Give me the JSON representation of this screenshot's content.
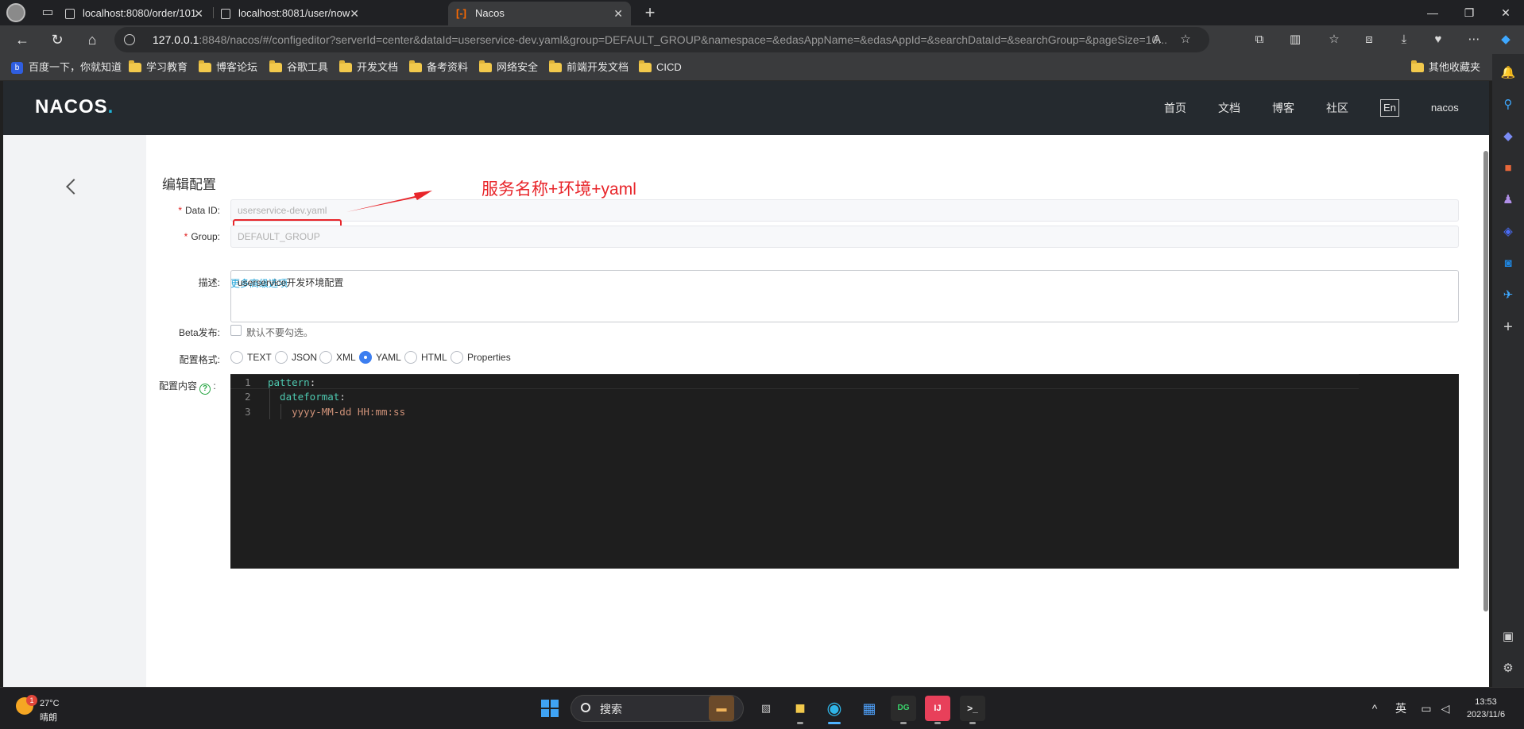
{
  "browser": {
    "tabs": [
      {
        "title": "localhost:8080/order/101"
      },
      {
        "title": "localhost:8081/user/now"
      },
      {
        "title": "Nacos"
      }
    ],
    "url": {
      "host": "127.0.0.1",
      "rest": ":8848/nacos/#/configeditor?serverId=center&dataId=userservice-dev.yaml&group=DEFAULT_GROUP&namespace=&edasAppName=&edasAppId=&searchDataId=&searchGroup=&pageSize=10..."
    },
    "bookmarks": [
      "百度一下，你就知道",
      "学习教育",
      "博客论坛",
      "谷歌工具",
      "开发文档",
      "备考资料",
      "网络安全",
      "前端开发文档",
      "CICD"
    ],
    "other_bookmarks": "其他收藏夹"
  },
  "nacos": {
    "logo": "NACOS",
    "logo_dot": ".",
    "nav": [
      "首页",
      "文档",
      "博客",
      "社区"
    ],
    "lang": "En",
    "user": "nacos"
  },
  "form": {
    "title": "编辑配置",
    "data_id_label": "Data ID:",
    "data_id_value": "userservice-dev.yaml",
    "group_label": "Group:",
    "group_value": "DEFAULT_GROUP",
    "required_mark": "*",
    "more_options": "更多高级选项",
    "desc_label": "描述:",
    "desc_value": "userservice开发环境配置",
    "beta_label": "Beta发布:",
    "beta_hint": "默认不要勾选。",
    "format_label": "配置格式:",
    "formats": [
      "TEXT",
      "JSON",
      "XML",
      "YAML",
      "HTML",
      "Properties"
    ],
    "selected_format": "YAML",
    "content_label": "配置内容",
    "help_glyph": "?",
    "colon": ":"
  },
  "editor": {
    "lines": [
      {
        "n": "1",
        "key": "pattern",
        "punc": ":",
        "str": ""
      },
      {
        "n": "2",
        "key": "  dateformat",
        "punc": ":",
        "str": ""
      },
      {
        "n": "3",
        "key": "",
        "punc": "",
        "str": "    yyyy-MM-dd HH:mm:ss"
      }
    ]
  },
  "annotation": {
    "text": "服务名称+环境+yaml",
    "color": "#e8262b"
  },
  "taskbar": {
    "temp": "27°C",
    "weather": "晴朗",
    "badge": "1",
    "search": "搜索",
    "ime": "英",
    "time": "13:53",
    "date": "2023/11/6"
  }
}
